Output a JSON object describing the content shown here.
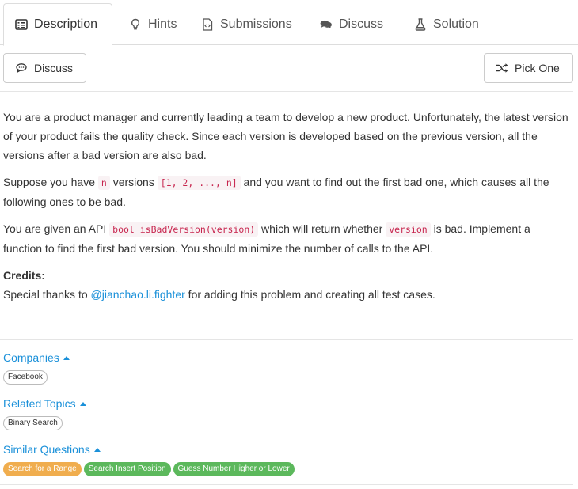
{
  "tabs": [
    {
      "label": "Description",
      "icon": "description-icon"
    },
    {
      "label": "Hints",
      "icon": "lightbulb-icon"
    },
    {
      "label": "Submissions",
      "icon": "code-file-icon"
    },
    {
      "label": "Discuss",
      "icon": "comments-icon"
    },
    {
      "label": "Solution",
      "icon": "flask-icon"
    }
  ],
  "toolbar": {
    "discuss_label": "Discuss",
    "pick_one_label": "Pick One"
  },
  "problem": {
    "p1": "You are a product manager and currently leading a team to develop a new product. Unfortunately, the latest version of your product fails the quality check. Since each version is developed based on the previous version, all the versions after a bad version are also bad.",
    "p2_a": "Suppose you have ",
    "p2_code1": "n",
    "p2_b": " versions ",
    "p2_code2": "[1, 2, ..., n]",
    "p2_c": " and you want to find out the first bad one, which causes all the following ones to be bad.",
    "p3_a": "You are given an API ",
    "p3_code1": "bool isBadVersion(version)",
    "p3_b": " which will return whether ",
    "p3_code2": "version",
    "p3_c": " is bad. Implement a function to find the first bad version. You should minimize the number of calls to the API.",
    "credits_title": "Credits:",
    "credits_a": "Special thanks to ",
    "credits_link": "@jianchao.li.fighter",
    "credits_b": " for adding this problem and creating all test cases."
  },
  "companies": {
    "title": "Companies",
    "tags": [
      "Facebook"
    ]
  },
  "related_topics": {
    "title": "Related Topics",
    "tags": [
      "Binary Search"
    ]
  },
  "similar_questions": {
    "title": "Similar Questions",
    "tags": [
      {
        "label": "Search for a Range",
        "difficulty": "medium",
        "color": "#f0ad4e"
      },
      {
        "label": "Search Insert Position",
        "difficulty": "easy",
        "color": "#5cb85c"
      },
      {
        "label": "Guess Number Higher or Lower",
        "difficulty": "easy",
        "color": "#5cb85c"
      }
    ]
  },
  "colors": {
    "link": "#1a90d9",
    "code_text": "#c7254e",
    "code_bg": "#f9f2f4"
  }
}
